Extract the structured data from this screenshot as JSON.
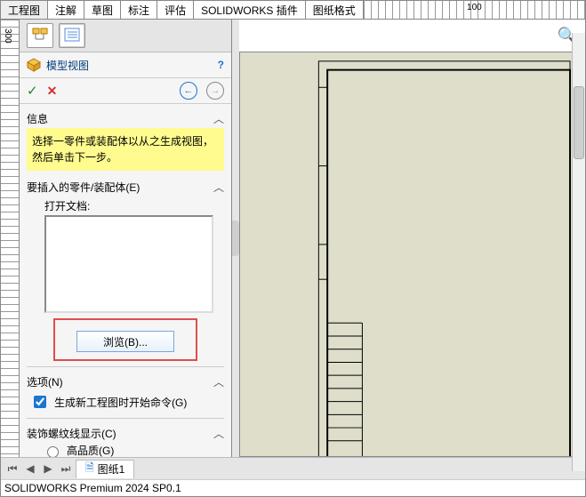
{
  "tabs": [
    "工程图",
    "注解",
    "草图",
    "标注",
    "评估",
    "SOLIDWORKS 插件",
    "图纸格式"
  ],
  "active_tab_index": 0,
  "ruler": {
    "h_label": "100",
    "v_label": "300"
  },
  "pm": {
    "title": "模型视图",
    "help_glyph": "?",
    "ok_glyph": "✓",
    "cancel_glyph": "✕",
    "back_glyph": "←",
    "fwd_glyph": "→",
    "info_heading": "信息",
    "info_text": "选择一零件或装配体以从之生成视图，然后单击下一步。",
    "insert_heading": "要插入的零件/装配体(E)",
    "open_docs_label": "打开文档:",
    "browse_label": "浏览(B)...",
    "options_heading": "选项(N)",
    "options_checkbox": "生成新工程图时开始命令(G)",
    "thread_heading": "装饰螺纹线显示(C)",
    "thread_hq": "高品质(G)",
    "expand_glyph": "︿"
  },
  "toolbar": {
    "magnifier_glyph": "🔍"
  },
  "sheet": {
    "nav_first": "⏮",
    "nav_prev": "◀",
    "nav_next": "▶",
    "nav_last": "⏭",
    "doc_glyph": "🗎",
    "tab_label": "图纸1"
  },
  "status": "SOLIDWORKS Premium 2024 SP0.1"
}
